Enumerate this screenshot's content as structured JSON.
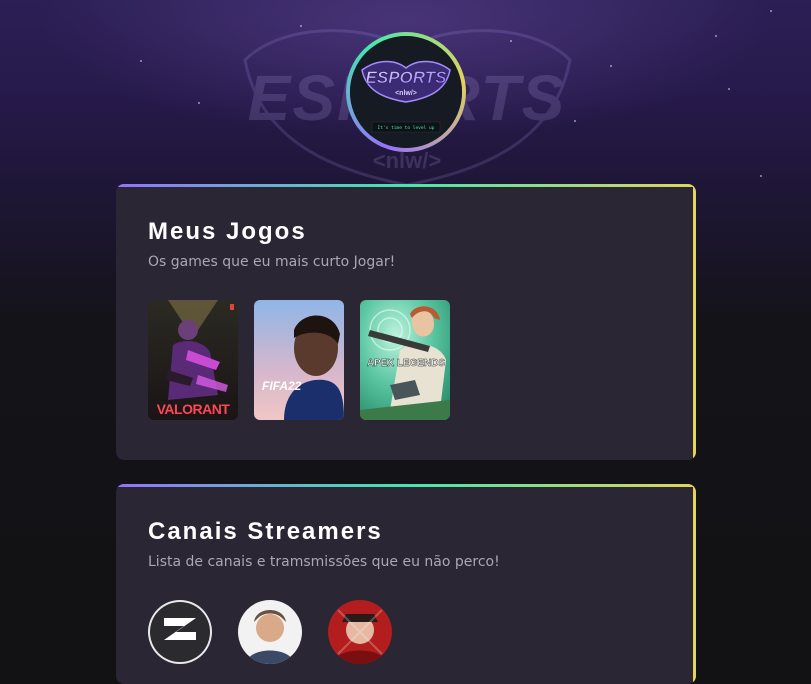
{
  "background": {
    "logo_text": "ESPORTS",
    "logo_subtext": "<nlw/>"
  },
  "avatar": {
    "logo_text": "ESPORTS",
    "logo_subtext": "<nlw/>",
    "tagline": "It's time to level up"
  },
  "games_section": {
    "title": "Meus Jogos",
    "subtitle": "Os games que eu mais curto Jogar!",
    "games": [
      {
        "name": "VALORANT",
        "icon": "valorant-cover"
      },
      {
        "name": "FIFA22",
        "icon": "fifa22-cover"
      },
      {
        "name": "APEX LEGENDS",
        "icon": "apex-cover"
      }
    ]
  },
  "streamers_section": {
    "title": "Canais Streamers",
    "subtitle": "Lista de canais e tramsmissões que eu não perco!",
    "streamers": [
      {
        "icon": "streamer-logo-avatar"
      },
      {
        "icon": "streamer-person-avatar"
      },
      {
        "icon": "streamer-red-avatar"
      }
    ]
  },
  "colors": {
    "accent_purple": "#9572fc",
    "accent_green": "#43e7ad",
    "accent_yellow": "#e2d45c",
    "card_bg": "#2a2634",
    "page_bg": "#121214"
  }
}
